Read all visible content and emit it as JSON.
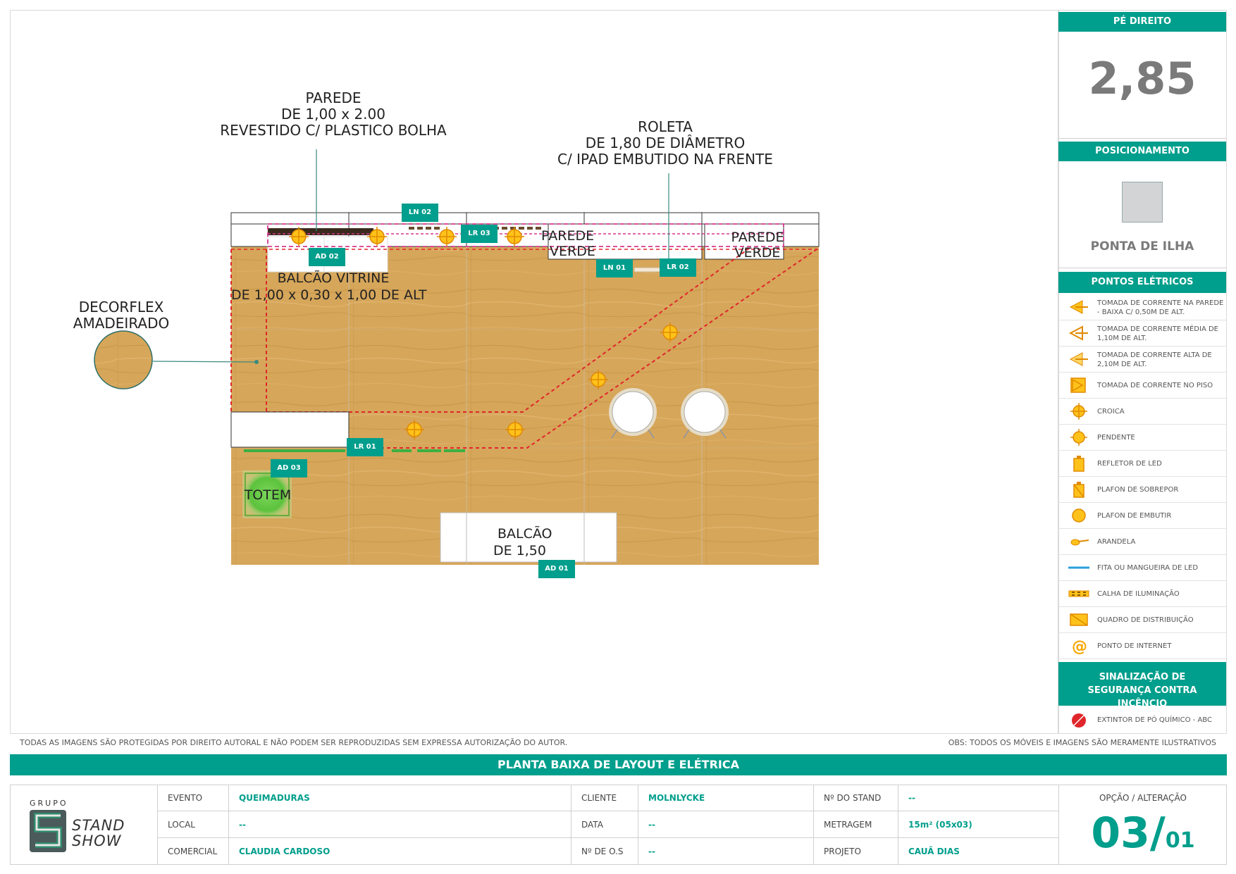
{
  "plan": {
    "callouts": {
      "parede": [
        "PAREDE",
        "DE 1,00 x 2.00",
        "REVESTIDO C/ PLASTICO BOLHA"
      ],
      "roleta": [
        "ROLETA",
        "DE 1,80 DE DIÂMETRO",
        "C/ IPAD EMBUTIDO NA FRENTE"
      ],
      "decorflex": [
        "DECORFLEX",
        "AMADEIRADO"
      ]
    },
    "labels": {
      "parede_verde_1": [
        "PAREDE",
        "VERDE"
      ],
      "parede_verde_2": [
        "PAREDE",
        "VERDE"
      ],
      "balcao_vitrine": [
        "BALCÃO VITRINE",
        "DE 1,00 x 0,30 x 1,00 DE ALT"
      ],
      "totem": "TOTEM",
      "balcao": [
        "BALCÃO",
        "DE 1,50"
      ]
    },
    "tags": {
      "ln02": "LN 02",
      "lr03": "LR 03",
      "ad02": "AD 02",
      "ln01": "LN 01",
      "lr02": "LR 02",
      "lr01": "LR 01",
      "ad03": "AD 03",
      "ad01": "AD 01"
    }
  },
  "sidebar": {
    "pe_direito_title": "PÉ DIREITO",
    "pe_direito_value": "2,85",
    "posicionamento_title": "POSICIONAMENTO",
    "posicionamento_value": "PONTA DE ILHA",
    "pontos_title": "PONTOS ELÉTRICOS",
    "legend": [
      {
        "icon": "wall-outlet-low-icon",
        "label": "TOMADA DE CORRENTE NA PAREDE - BAIXA C/ 0,50M DE ALT."
      },
      {
        "icon": "wall-outlet-mid-icon",
        "label": "TOMADA DE CORRENTE MÉDIA DE 1,10M DE ALT."
      },
      {
        "icon": "wall-outlet-high-icon",
        "label": "TOMADA DE CORRENTE ALTA DE 2,10M DE ALT."
      },
      {
        "icon": "floor-outlet-icon",
        "label": "TOMADA DE CORRENTE NO PISO"
      },
      {
        "icon": "croica-icon",
        "label": "CROICA"
      },
      {
        "icon": "pendant-icon",
        "label": "PENDENTE"
      },
      {
        "icon": "led-reflector-icon",
        "label": "REFLETOR DE LED"
      },
      {
        "icon": "surface-plafon-icon",
        "label": "PLAFON DE SOBREPOR"
      },
      {
        "icon": "recessed-plafon-icon",
        "label": "PLAFON DE EMBUTIR"
      },
      {
        "icon": "sconce-icon",
        "label": "ARANDELA"
      },
      {
        "icon": "led-strip-icon",
        "label": "FITA OU MANGUEIRA DE LED"
      },
      {
        "icon": "lighting-rail-icon",
        "label": "CALHA DE ILUMINAÇÃO"
      },
      {
        "icon": "distribution-board-icon",
        "label": "QUADRO DE DISTRIBUIÇÃO"
      },
      {
        "icon": "internet-point-icon",
        "label": "PONTO DE INTERNET"
      }
    ],
    "safety_title": "SINALIZAÇÃO DE SEGURANÇA CONTRA INCÊNCIO",
    "safety_item": "EXTINTOR DE PÓ QUÍMICO - ABC"
  },
  "footer": {
    "copyright": "TODAS AS IMAGENS SÃO PROTEGIDAS POR DIREITO AUTORAL E NÃO PODEM SER REPRODUZIDAS SEM EXPRESSA AUTORIZAÇÃO DO AUTOR.",
    "obs": "OBS: TODOS OS MÓVEIS E IMAGENS SÃO MERAMENTE ILUSTRATIVOS",
    "title": "PLANTA BAIXA DE LAYOUT E ELÉTRICA",
    "logo": {
      "grupo": "GRUPO",
      "stand": "STAND",
      "show": "SHOW"
    },
    "info": {
      "evento_label": "EVENTO",
      "evento_value": "QUEIMADURAS",
      "cliente_label": "CLIENTE",
      "cliente_value": "MOLNLYCKE",
      "stand_label": "Nº DO STAND",
      "stand_value": "--",
      "local_label": "LOCAL",
      "local_value": "--",
      "data_label": "DATA",
      "data_value": "--",
      "metragem_label": "METRAGEM",
      "metragem_value": "15m² (05x03)",
      "comercial_label": "COMERCIAL",
      "comercial_value": "CLAUDIA CARDOSO",
      "os_label": "Nº DE O.S",
      "os_value": "--",
      "projeto_label": "PROJETO",
      "projeto_value": "CAUÃ DIAS"
    },
    "opcao_label": "OPÇÃO / ALTERAÇÃO",
    "opcao_value": "03/",
    "alteracao_value": "01"
  },
  "colors": {
    "accent": "#009e8c",
    "outlet": "#f7a600",
    "dashed": "#e0262b",
    "magenta": "#d6378f",
    "wood": "#d7a75a"
  }
}
